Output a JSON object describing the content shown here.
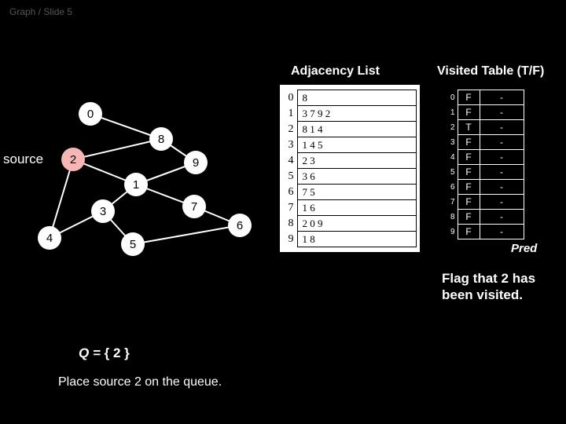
{
  "header": "Graph / Slide 5",
  "titles": {
    "adjacency": "Adjacency List",
    "visited": "Visited Table (T/F)"
  },
  "adjacency": [
    {
      "idx": "0",
      "vals": "8"
    },
    {
      "idx": "1",
      "vals": "3   7   9   2"
    },
    {
      "idx": "2",
      "vals": "8   1   4"
    },
    {
      "idx": "3",
      "vals": "1   4   5"
    },
    {
      "idx": "4",
      "vals": "2   3"
    },
    {
      "idx": "5",
      "vals": "3   6"
    },
    {
      "idx": "6",
      "vals": "7   5"
    },
    {
      "idx": "7",
      "vals": "1   6"
    },
    {
      "idx": "8",
      "vals": "2   0   9"
    },
    {
      "idx": "9",
      "vals": "1   8"
    }
  ],
  "visited": [
    {
      "i": "0",
      "v": "F",
      "p": "-"
    },
    {
      "i": "1",
      "v": "F",
      "p": "-"
    },
    {
      "i": "2",
      "v": "T",
      "p": "-"
    },
    {
      "i": "3",
      "v": "F",
      "p": "-"
    },
    {
      "i": "4",
      "v": "F",
      "p": "-"
    },
    {
      "i": "5",
      "v": "F",
      "p": "-"
    },
    {
      "i": "6",
      "v": "F",
      "p": "-"
    },
    {
      "i": "7",
      "v": "F",
      "p": "-"
    },
    {
      "i": "8",
      "v": "F",
      "p": "-"
    },
    {
      "i": "9",
      "v": "F",
      "p": "-"
    }
  ],
  "predLabel": "Pred",
  "flagText": "Flag that 2 has been visited.",
  "sourceLabel": "source",
  "queueLabel": "Q = ",
  "queueContent": "{  2  }",
  "placeText": "Place source 2 on the queue.",
  "nodes": {
    "n0": "0",
    "n1": "1",
    "n2": "2",
    "n3": "3",
    "n4": "4",
    "n5": "5",
    "n6": "6",
    "n7": "7",
    "n8": "8",
    "n9": "9"
  }
}
